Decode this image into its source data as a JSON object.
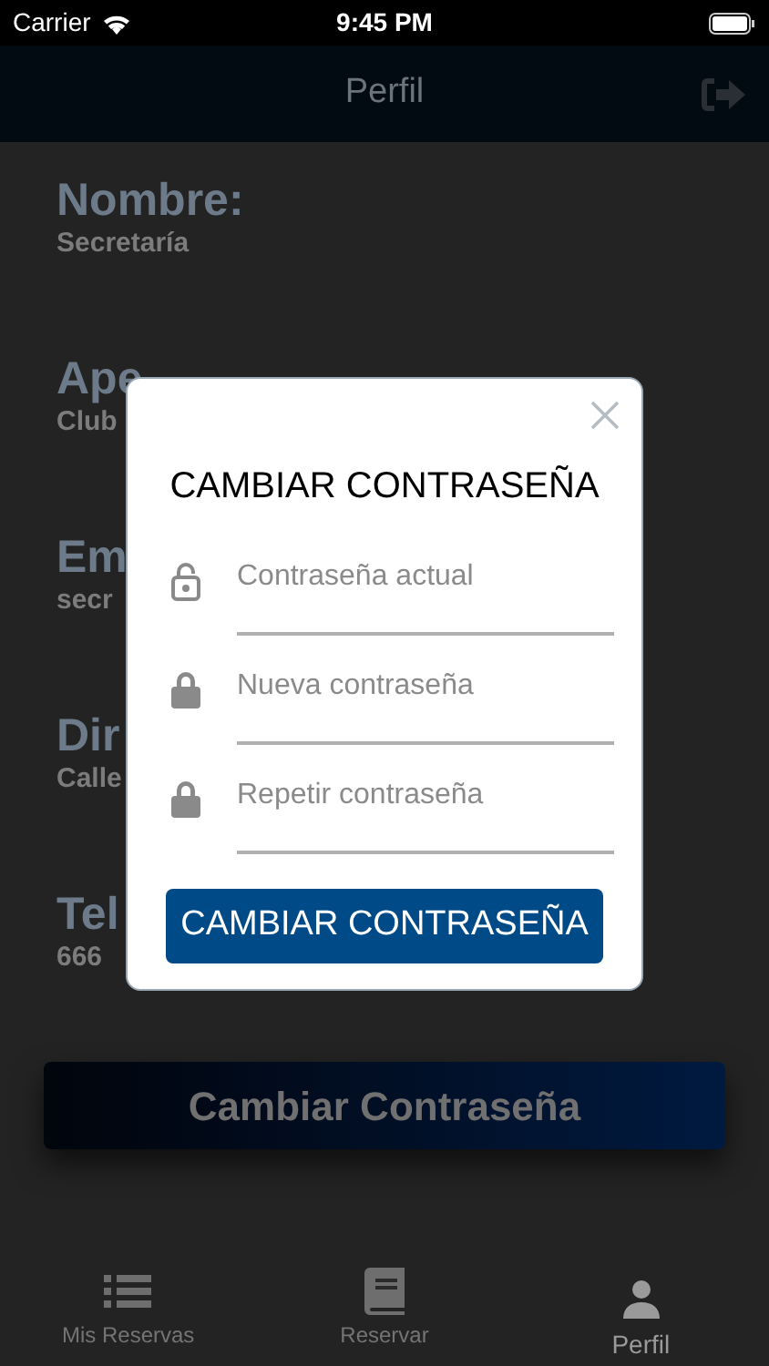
{
  "status_bar": {
    "carrier": "Carrier",
    "time": "9:45 PM"
  },
  "header": {
    "title": "Perfil"
  },
  "fields": [
    {
      "label": "Nombre:",
      "value": "Secretaría"
    },
    {
      "label": "Ape",
      "value": "Club"
    },
    {
      "label": "Em",
      "value": "secr"
    },
    {
      "label": "Dir",
      "value": "Calle"
    },
    {
      "label": "Tel",
      "value": "666"
    }
  ],
  "change_password_button": "Cambiar Contraseña",
  "dialog": {
    "title": "CAMBIAR CONTRASEÑA",
    "inputs": [
      {
        "placeholder": "Contraseña actual",
        "locked": false
      },
      {
        "placeholder": "Nueva contraseña",
        "locked": true
      },
      {
        "placeholder": "Repetir contraseña",
        "locked": true
      }
    ],
    "submit": "CAMBIAR CONTRASEÑA"
  },
  "tabs": [
    {
      "label": "Mis Reservas",
      "kind": "list",
      "selected": false
    },
    {
      "label": "Reservar",
      "kind": "book",
      "selected": false
    },
    {
      "label": "Perfil",
      "kind": "person",
      "selected": true
    }
  ]
}
